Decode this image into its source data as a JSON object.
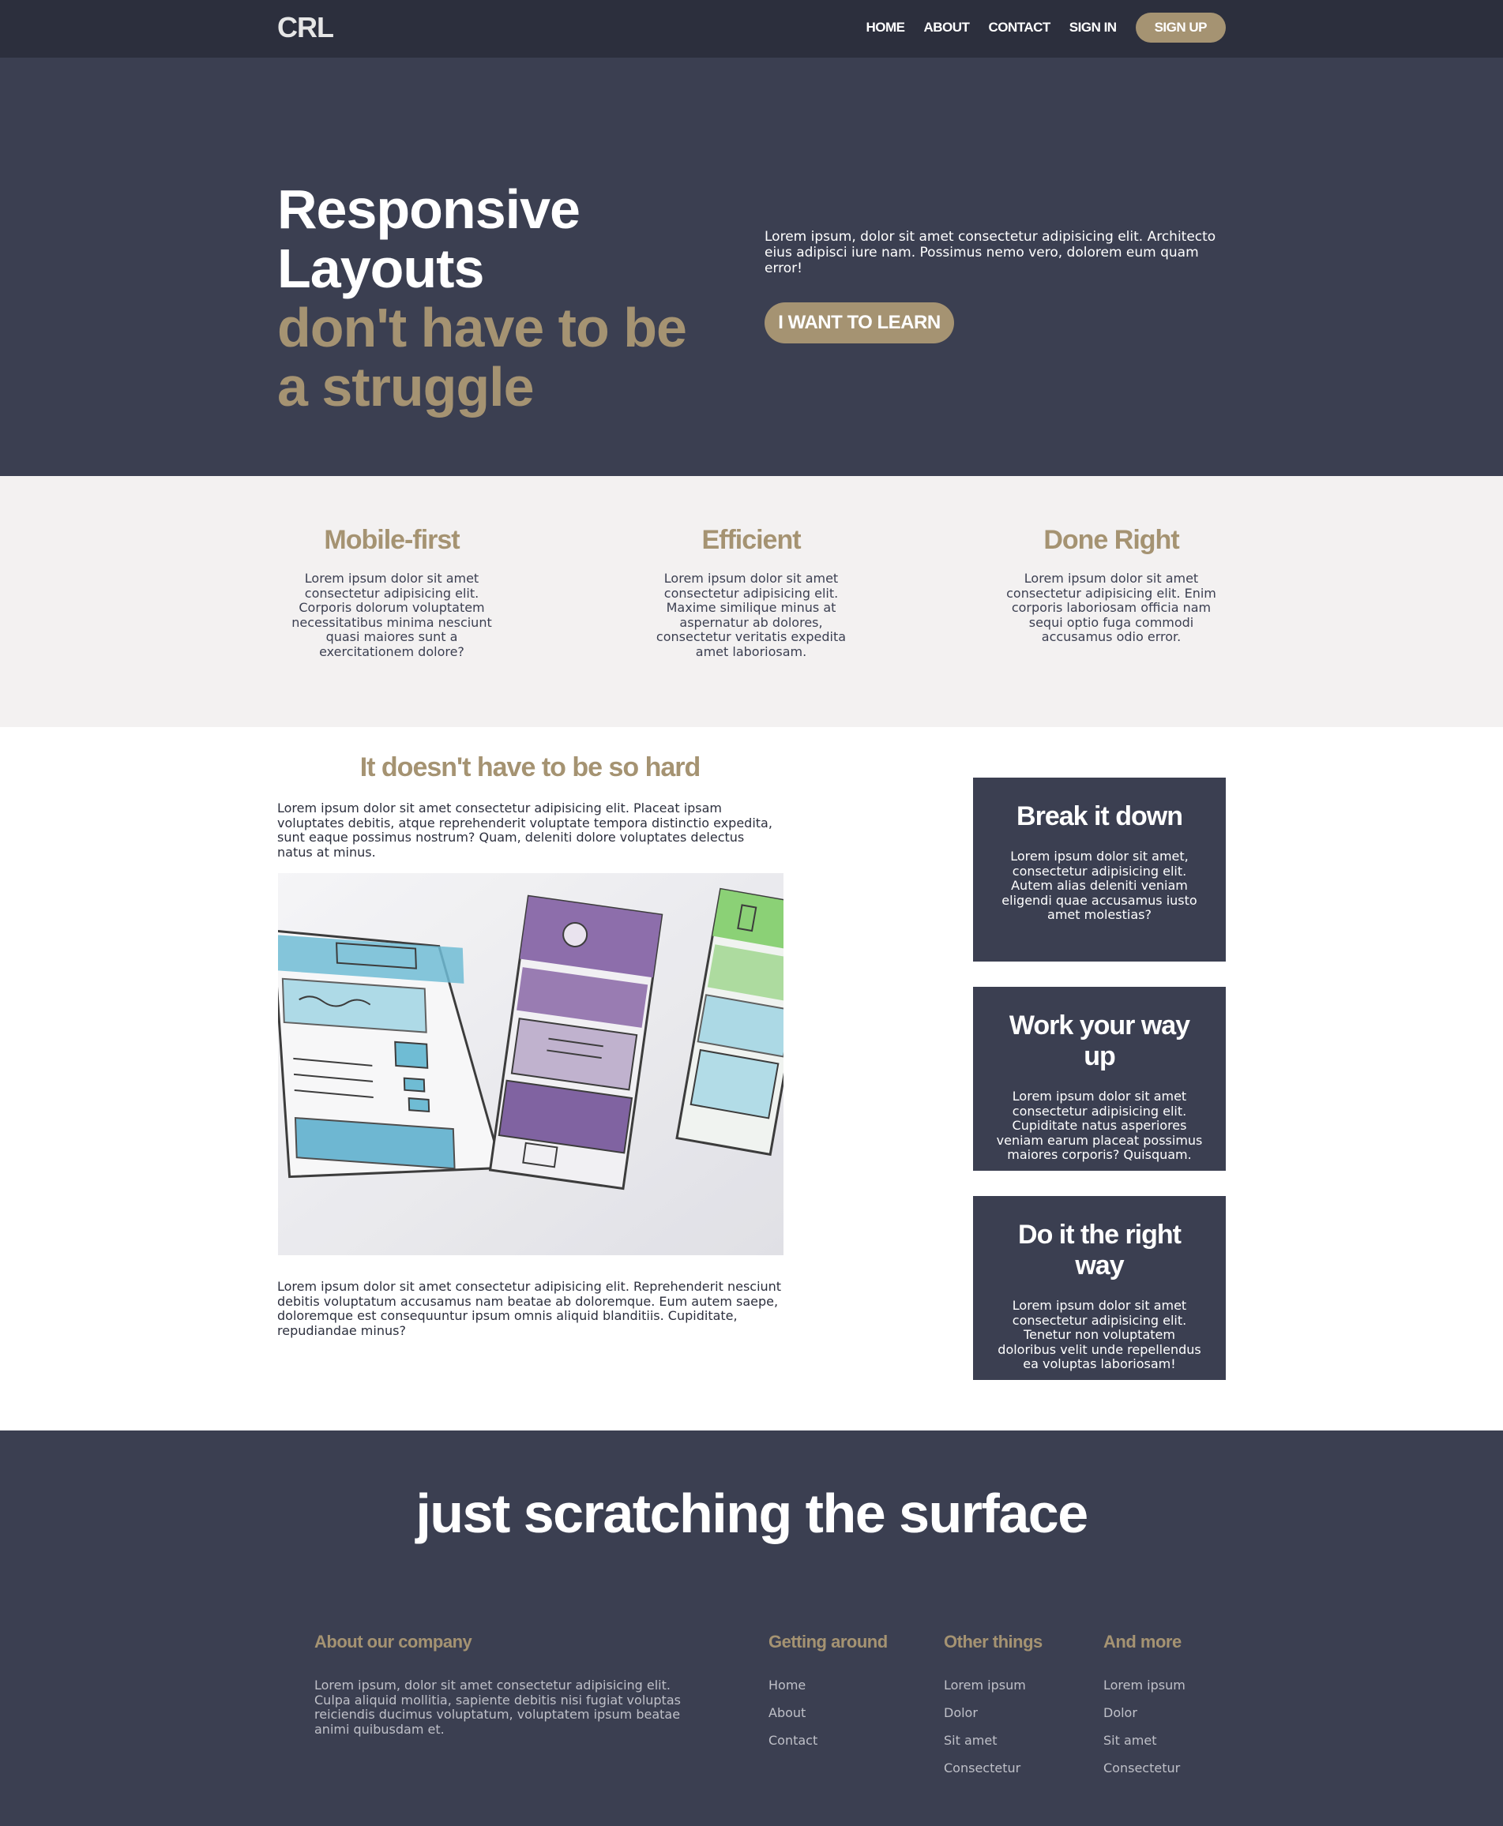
{
  "nav": {
    "logo": "CRL",
    "links": [
      "HOME",
      "ABOUT",
      "CONTACT",
      "SIGN IN"
    ],
    "signup": "SIGN UP"
  },
  "hero": {
    "title_line1": "Responsive Layouts",
    "title_line2": "don't have to be a struggle",
    "text": "Lorem ipsum, dolor sit amet consectetur adipisicing elit. Architecto eius adipisci iure nam. Possimus nemo vero, dolorem eum quam error!",
    "button": "I WANT TO LEARN"
  },
  "features": [
    {
      "title": "Mobile-first",
      "text": "Lorem ipsum dolor sit amet consectetur adipisicing elit. Corporis dolorum voluptatem necessitatibus minima nesciunt quasi maiores sunt a exercitationem dolore?"
    },
    {
      "title": "Efficient",
      "text": "Lorem ipsum dolor sit amet consectetur adipisicing elit. Maxime similique minus at aspernatur ab dolores, consectetur veritatis expedita amet laboriosam."
    },
    {
      "title": "Done Right",
      "text": "Lorem ipsum dolor sit amet consectetur adipisicing elit. Enim corporis laboriosam officia nam sequi optio fuga commodi accusamus odio error."
    }
  ],
  "main": {
    "title": "It doesn't have to be so hard",
    "p1": "Lorem ipsum dolor sit amet consectetur adipisicing elit. Placeat ipsam voluptates debitis, atque reprehenderit voluptate tempora distinctio expedita, sunt eaque possimus nostrum? Quam, deleniti dolore voluptates delectus natus at minus.",
    "p2": "Lorem ipsum dolor sit amet consectetur adipisicing elit. Reprehenderit nesciunt debitis voluptatum accusamus nam beatae ab doloremque. Eum autem saepe, doloremque est consequuntur ipsum omnis aliquid blanditiis. Cupiditate, repudiandae minus?"
  },
  "cards": [
    {
      "title": "Break it down",
      "text": "Lorem ipsum dolor sit amet, consectetur adipisicing elit. Autem alias deleniti veniam eligendi quae accusamus iusto amet molestias?"
    },
    {
      "title": "Work your way up",
      "text": "Lorem ipsum dolor sit amet consectetur adipisicing elit. Cupiditate natus asperiores veniam earum placeat possimus maiores corporis? Quisquam."
    },
    {
      "title": "Do it the right way",
      "text": "Lorem ipsum dolor sit amet consectetur adipisicing elit. Tenetur non voluptatem doloribus velit unde repellendus ea voluptas laboriosam!"
    }
  ],
  "footer": {
    "title": "just scratching the surface",
    "about": {
      "heading": "About our company",
      "text": "Lorem ipsum, dolor sit amet consectetur adipisicing elit. Culpa aliquid mollitia, sapiente debitis nisi fugiat voluptas reiciendis ducimus voluptatum, voluptatem ipsum beatae animi quibusdam et."
    },
    "columns": [
      {
        "heading": "Getting around",
        "items": [
          "Home",
          "About",
          "Contact"
        ]
      },
      {
        "heading": "Other things",
        "items": [
          "Lorem ipsum",
          "Dolor",
          "Sit amet",
          "Consectetur"
        ]
      },
      {
        "heading": "And more",
        "items": [
          "Lorem ipsum",
          "Dolor",
          "Sit amet",
          "Consectetur"
        ]
      }
    ]
  },
  "colors": {
    "dark": "#3b3f51",
    "nav": "#2c2f3d",
    "accent": "#a59372",
    "light": "#f3f1f1"
  }
}
